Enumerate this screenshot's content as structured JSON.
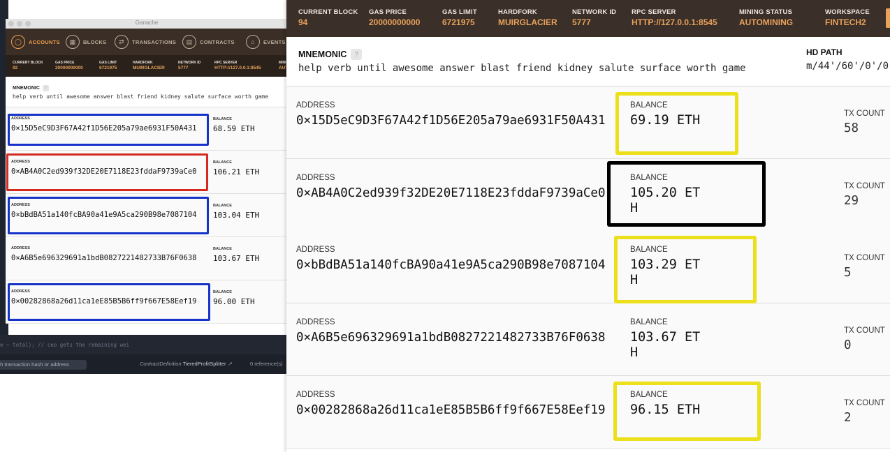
{
  "small_window": {
    "title": "Ganache",
    "nav": [
      {
        "label": "ACCOUNTS",
        "icon": "account-icon",
        "glyph": "◯",
        "active": true
      },
      {
        "label": "BLOCKS",
        "icon": "blocks-icon",
        "glyph": "▦",
        "active": false
      },
      {
        "label": "TRANSACTIONS",
        "icon": "transactions-icon",
        "glyph": "⇄",
        "active": false
      },
      {
        "label": "CONTRACTS",
        "icon": "contracts-icon",
        "glyph": "▤",
        "active": false
      },
      {
        "label": "EVENTS",
        "icon": "bell-icon",
        "glyph": "⌂",
        "active": false
      }
    ],
    "stats": [
      {
        "label": "CURRENT BLOCK",
        "value": "92"
      },
      {
        "label": "GAS PRICE",
        "value": "20000000000"
      },
      {
        "label": "GAS LIMIT",
        "value": "6721975"
      },
      {
        "label": "HARDFORK",
        "value": "MUIRGLACIER"
      },
      {
        "label": "NETWORK ID",
        "value": "5777"
      },
      {
        "label": "RPC SERVER",
        "value": "HTTP://127.0.0.1:8545"
      },
      {
        "label": "MINI",
        "value": "AUT"
      }
    ],
    "mnemonic_label": "MNEMONIC",
    "mnemonic_help": "?",
    "mnemonic": "help verb until awesome answer blast friend kidney salute surface worth game",
    "address_label": "ADDRESS",
    "balance_label": "BALANCE",
    "accounts": [
      {
        "address": "0×15D5eC9D3F67A42f1D56E205a79ae6931F50A431",
        "balance": "68.59 ETH",
        "highlight": "#1533c9"
      },
      {
        "address": "0×AB4A0C2ed939f32DE20E7118E23fddaF9739aCe0",
        "balance": "106.21 ETH",
        "highlight": "#d42a20"
      },
      {
        "address": "0×bBdBA51a140fcBA90a41e9A5ca290B98e7087104",
        "balance": "103.04 ETH",
        "highlight": "#1533c9"
      },
      {
        "address": "0×A6B5e696329691a1bdB0827221482733B76F0638",
        "balance": "103.67 ETH",
        "highlight": null
      },
      {
        "address": "0×00282868a26d11ca1eE85B5B6ff9f667E58Eef19",
        "balance": "96.00 ETH",
        "highlight": "#1533c9"
      }
    ],
    "code_line": "e – total); // ceo gets the remaining wei",
    "search_placeholder": "th transaction hash or address",
    "contract_def_prefix": "ContractDefinition",
    "contract_def_name": "TieredProfitSplitter",
    "contract_def_arrow": "↗",
    "refs": "0 reference(s)"
  },
  "large_window": {
    "stats": [
      {
        "label": "CURRENT BLOCK",
        "value": "94"
      },
      {
        "label": "GAS PRICE",
        "value": "20000000000"
      },
      {
        "label": "GAS LIMIT",
        "value": "6721975"
      },
      {
        "label": "HARDFORK",
        "value": "MUIRGLACIER"
      },
      {
        "label": "NETWORK ID",
        "value": "5777"
      },
      {
        "label": "RPC SERVER",
        "value": "HTTP://127.0.0.1:8545"
      },
      {
        "label": "MINING STATUS",
        "value": "AUTOMINING"
      },
      {
        "label": "WORKSPACE",
        "value": "FINTECH2"
      }
    ],
    "mnemonic_label": "MNEMONIC",
    "mnemonic_help": "?",
    "mnemonic": "help verb until awesome answer blast friend kidney salute surface worth game",
    "hd_path_label": "HD PATH",
    "hd_path": "m/44'/60'/0'/0",
    "address_label": "ADDRESS",
    "balance_label": "BALANCE",
    "tx_count_label": "TX COUNT",
    "accounts": [
      {
        "address": "0×15D5eC9D3F67A42f1D56E205a79ae6931F50A431",
        "balance": "69.19 ETH",
        "tx_count": "58",
        "highlight": "#ebe01b"
      },
      {
        "address": "0×AB4A0C2ed939f32DE20E7118E23fddaF9739aCe0",
        "balance": "105.20 ETH",
        "tx_count": "29",
        "highlight": "#000000"
      },
      {
        "address": "0×bBdBA51a140fcBA90a41e9A5ca290B98e7087104",
        "balance": "103.29 ETH",
        "tx_count": "5",
        "highlight": "#ebe01b"
      },
      {
        "address": "0×A6B5e696329691a1bdB0827221482733B76F0638",
        "balance": "103.67 ETH",
        "tx_count": "0",
        "highlight": null
      },
      {
        "address": "0×00282868a26d11ca1eE85B5B6ff9f667E58Eef19",
        "balance": "96.15 ETH",
        "tx_count": "2",
        "highlight": "#ebe01b"
      }
    ]
  },
  "colors": {
    "nav_bg": "#3a2e26",
    "stats_bg": "#3a2f29",
    "accent": "#e8a25b",
    "blue_highlight": "#1533c9",
    "red_highlight": "#d42a20",
    "yellow_highlight": "#ebe01b",
    "black_highlight": "#000000"
  }
}
